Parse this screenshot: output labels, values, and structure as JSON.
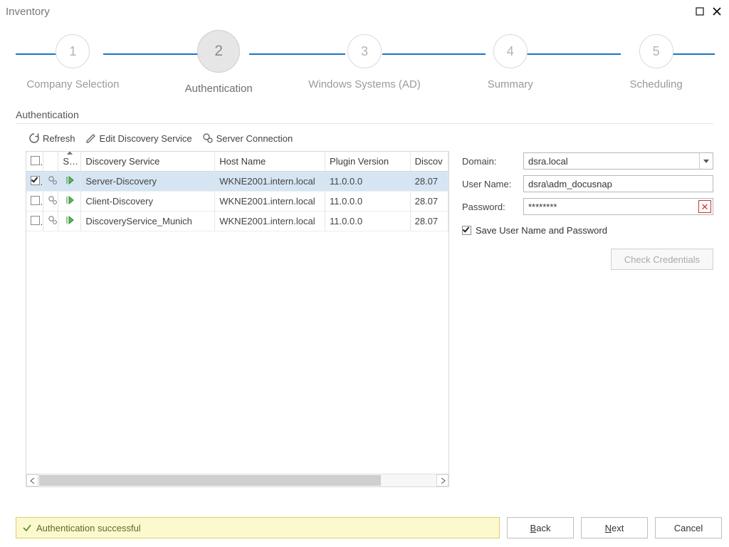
{
  "window": {
    "title": "Inventory"
  },
  "stepper": {
    "steps": [
      {
        "num": "1",
        "label": "Company Selection"
      },
      {
        "num": "2",
        "label": "Authentication"
      },
      {
        "num": "3",
        "label": "Windows Systems (AD)"
      },
      {
        "num": "4",
        "label": "Summary"
      },
      {
        "num": "5",
        "label": "Scheduling"
      }
    ],
    "active_index": 1
  },
  "section": {
    "title": "Authentication"
  },
  "toolbar": {
    "refresh": "Refresh",
    "edit": "Edit Discovery Service",
    "server": "Server Connection"
  },
  "table": {
    "headers": {
      "status": "Status",
      "service": "Discovery Service",
      "host": "Host Name",
      "version": "Plugin Version",
      "date": "Discov"
    },
    "rows": [
      {
        "checked": true,
        "service": "Server-Discovery",
        "host": "WKNE2001.intern.local",
        "version": "11.0.0.0",
        "date": "28.07"
      },
      {
        "checked": false,
        "service": "Client-Discovery",
        "host": "WKNE2001.intern.local",
        "version": "11.0.0.0",
        "date": "28.07"
      },
      {
        "checked": false,
        "service": "DiscoveryService_Munich",
        "host": "WKNE2001.intern.local",
        "version": "11.0.0.0",
        "date": "28.07"
      }
    ]
  },
  "form": {
    "domain_label": "Domain:",
    "domain_value": "dsra.local",
    "user_label": "User Name:",
    "user_value": "dsra\\adm_docusnap",
    "pwd_label": "Password:",
    "pwd_value": "********",
    "save_label": "Save User Name and Password",
    "save_checked": true,
    "check_btn": "Check Credentials"
  },
  "status": {
    "text": "Authentication successful"
  },
  "buttons": {
    "back": "Back",
    "next": "Next",
    "cancel": "Cancel"
  }
}
